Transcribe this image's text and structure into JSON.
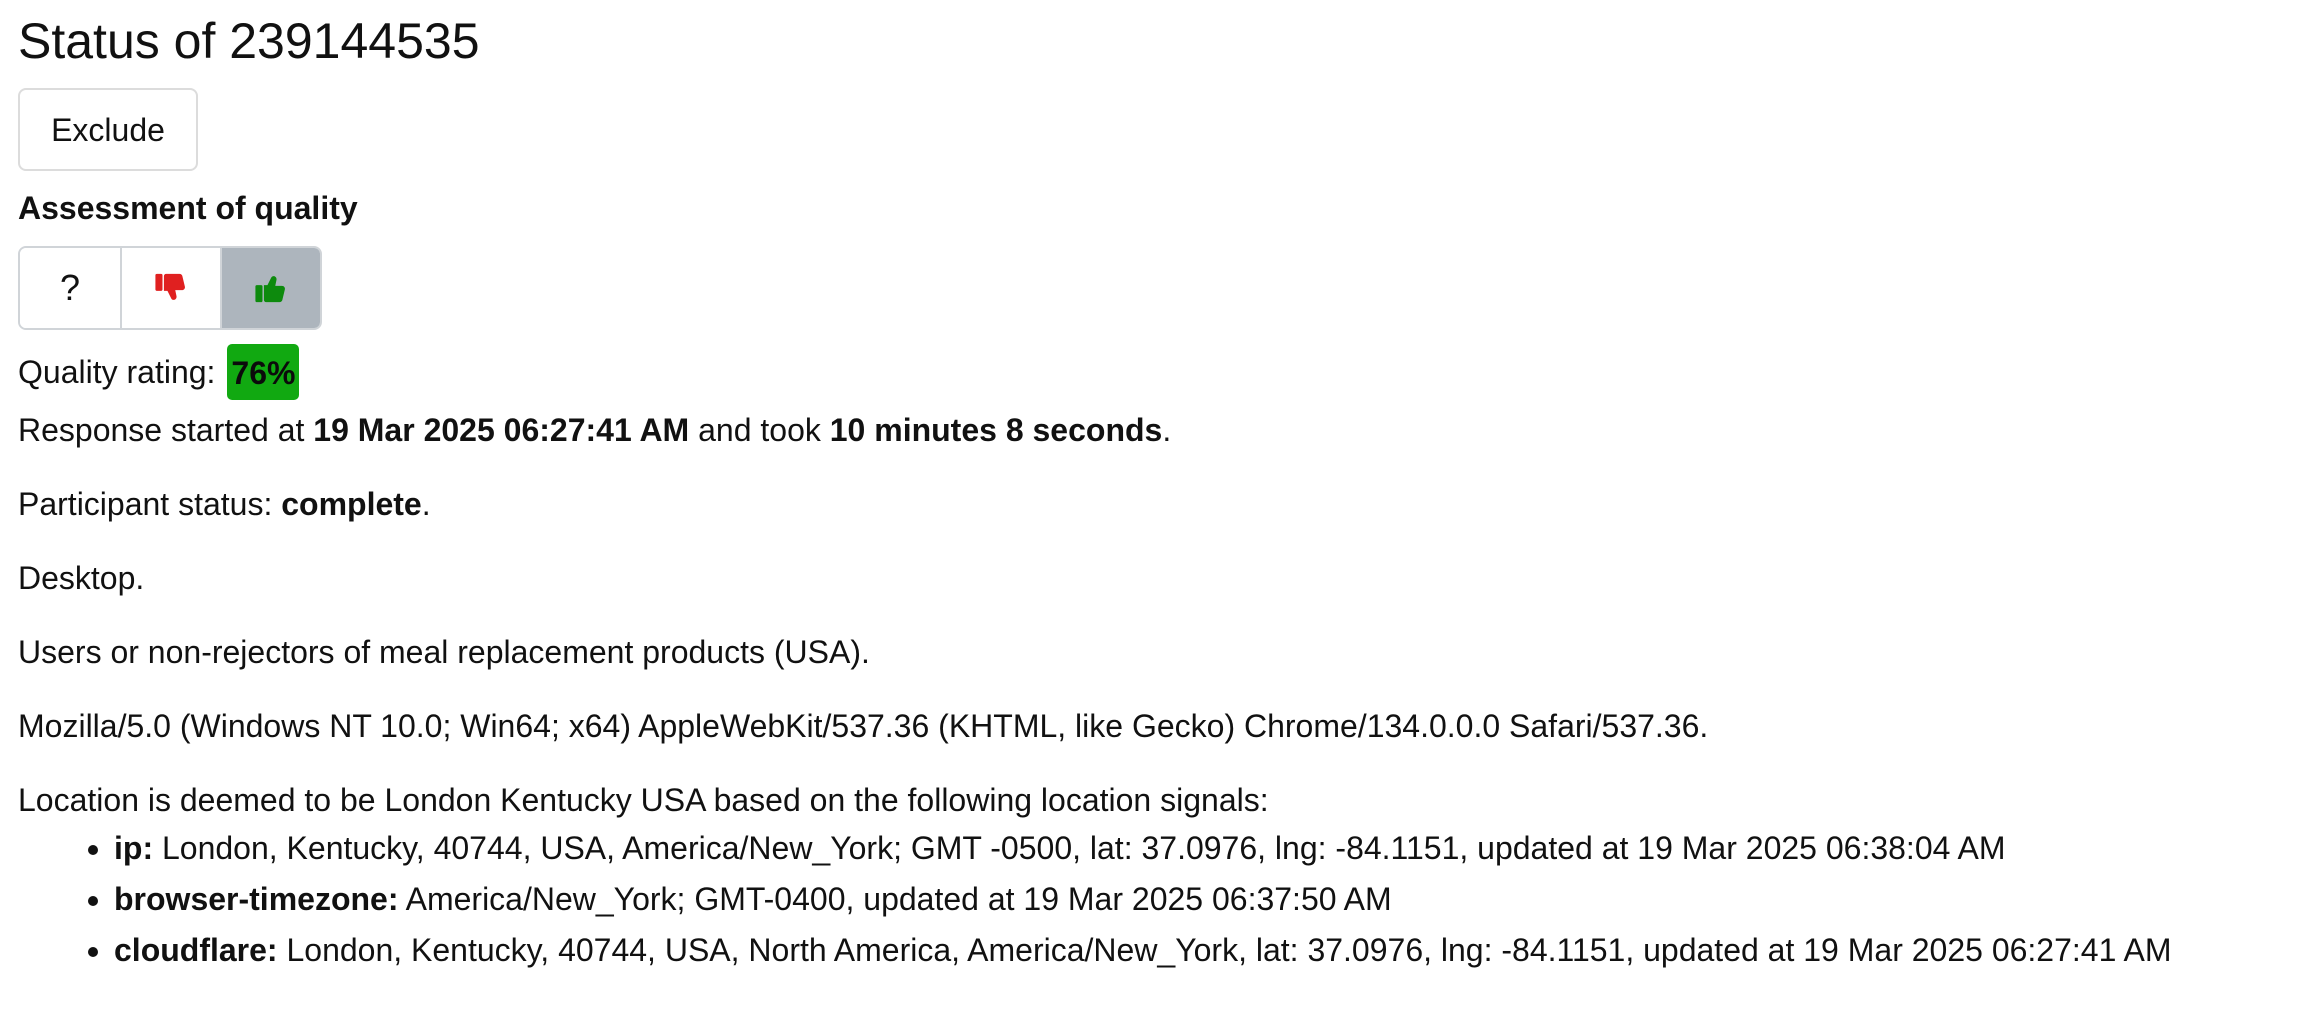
{
  "page": {
    "title": "Status of 239144535"
  },
  "exclude_button": {
    "label": "Exclude"
  },
  "quality": {
    "heading": "Assessment of quality",
    "buttons": [
      {
        "name": "unknown",
        "label": "?",
        "icon": "question-mark",
        "active": false
      },
      {
        "name": "thumbs-down",
        "label": "",
        "icon": "thumbs-down-icon",
        "color": "#e02020",
        "active": false
      },
      {
        "name": "thumbs-up",
        "label": "",
        "icon": "thumbs-up-icon",
        "color": "#0d8a0d",
        "active": true
      }
    ],
    "rating_label": "Quality rating:",
    "rating_value": "76%",
    "rating_color": "#11a911"
  },
  "response": {
    "prefix": "Response started at ",
    "started_at": "19 Mar 2025 06:27:41 AM",
    "middle": " and took ",
    "duration": "10 minutes 8 seconds",
    "suffix": "."
  },
  "participant": {
    "prefix": "Participant status: ",
    "status": "complete",
    "suffix": "."
  },
  "device": "Desktop.",
  "segment": "Users or non-rejectors of meal replacement products (USA).",
  "user_agent": "Mozilla/5.0 (Windows NT 10.0; Win64; x64) AppleWebKit/537.36 (KHTML, like Gecko) Chrome/134.0.0.0 Safari/537.36.",
  "location": {
    "summary": "Location is deemed to be London Kentucky USA based on the following location signals:",
    "signals": [
      {
        "key": "ip:",
        "value": " London, Kentucky, 40744, USA, America/New_York; GMT -0500, lat: 37.0976, lng: -84.1151, updated at 19 Mar 2025 06:38:04 AM"
      },
      {
        "key": "browser-timezone:",
        "value": " America/New_York; GMT-0400, updated at 19 Mar 2025 06:37:50 AM"
      },
      {
        "key": "cloudflare:",
        "value": " London, Kentucky, 40744, USA, North America, America/New_York, lat: 37.0976, lng: -84.1151, updated at 19 Mar 2025 06:27:41 AM"
      }
    ]
  }
}
